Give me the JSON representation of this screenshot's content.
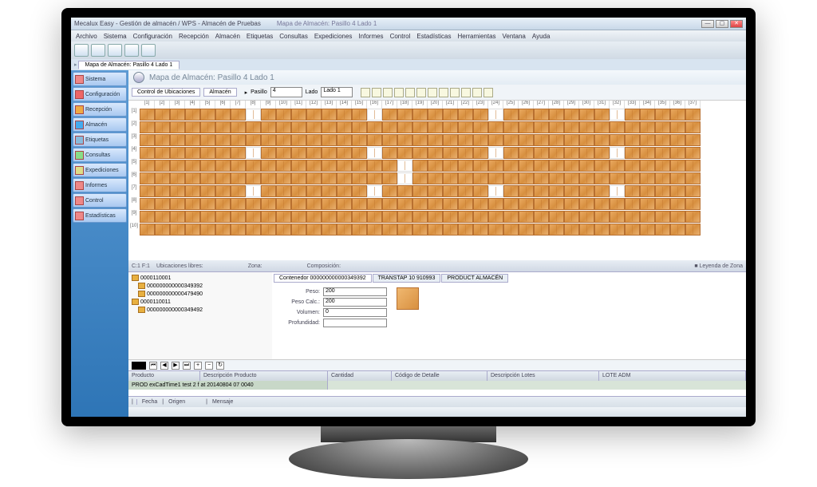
{
  "title": "Mecalux Easy - Gestión de almacén / WPS - Almacén de Pruebas",
  "tab_title": "Mapa de Almacén: Pasillo 4 Lado 1",
  "window": {
    "min": "—",
    "max": "▢",
    "close": "✕"
  },
  "menu": [
    "Archivo",
    "Sistema",
    "Configuración",
    "Recepción",
    "Almacén",
    "Etiquetas",
    "Consultas",
    "Expediciones",
    "Informes",
    "Control",
    "Estadísticas",
    "Herramientas",
    "Ventana",
    "Ayuda"
  ],
  "sidebar": [
    "Sistema",
    "Configuración",
    "Recepción",
    "Almacén",
    "Etiquetas",
    "Consultas",
    "Expediciones",
    "Informes",
    "Control",
    "Estadísticas"
  ],
  "doc_title": "Mapa de Almacén: Pasillo 4 Lado 1",
  "filters": {
    "tab1": "Control de Ubicaciones",
    "tab2": "Almacén",
    "pasillo_label": "Pasillo",
    "pasillo_value": "4",
    "lado_label": "Lado",
    "lado_value": "Lado 1"
  },
  "columns": [
    "[1]",
    "[2]",
    "[3]",
    "[4]",
    "[5]",
    "[6]",
    "[7]",
    "[8]",
    "[9]",
    "[10]",
    "[11]",
    "[12]",
    "[13]",
    "[14]",
    "[15]",
    "[16]",
    "[17]",
    "[18]",
    "[19]",
    "[20]",
    "[21]",
    "[22]",
    "[23]",
    "[24]",
    "[25]",
    "[26]",
    "[27]",
    "[28]",
    "[29]",
    "[30]",
    "[31]",
    "[32]",
    "[33]",
    "[34]",
    "[35]",
    "[36]",
    "[37]"
  ],
  "rows": [
    "[1]",
    "[2]",
    "[3]",
    "[4]",
    "[5]",
    "[6]",
    "[7]",
    "[8]",
    "[9]",
    "[10]"
  ],
  "footer": {
    "coord": "C:1 F:1",
    "ubicaciones": "Ubicaciones libres:",
    "zona": "Zona:",
    "composicion": "Composición:",
    "leyenda": "Leyenda de Zona"
  },
  "tree": [
    {
      "code": "0000110001",
      "desc": "000000000000349392"
    },
    {
      "code": "",
      "desc": "000000000000479490"
    },
    {
      "code": "0000110011",
      "desc": ""
    },
    {
      "code": "",
      "desc": "000000000000349492"
    }
  ],
  "detail": {
    "tabs": [
      "Contenedor 000000000000349392",
      "TRANSTAP 10 910993",
      "PRODUCT ALMACÉN"
    ],
    "fields": {
      "peso_label": "Peso:",
      "peso_value": "200",
      "pesocalc_label": "Peso Calc.:",
      "pesocalc_value": "200",
      "volumen_label": "Volumen:",
      "volumen_value": "0",
      "profundidad_label": "Profundidad:",
      "profundidad_value": ""
    }
  },
  "datagrid": {
    "cols": [
      "Producto",
      "Descripción Producto",
      "Cantidad",
      "Código de Detalle",
      "Descripción Lotes",
      "LOTE ADM"
    ],
    "row1": "PROD exCadTime1 test 2 f at 20140804 07 0040"
  },
  "msgbar": {
    "fecha": "Fecha",
    "origen": "Origen",
    "mensaje": "Mensaje"
  },
  "status": ""
}
